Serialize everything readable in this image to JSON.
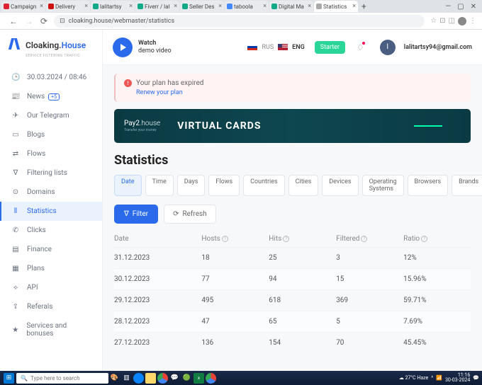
{
  "browser": {
    "tabs": [
      {
        "label": "Campaign",
        "color": "#d23"
      },
      {
        "label": "Delivery",
        "color": "#c11"
      },
      {
        "label": "lalitartsy",
        "color": "#1a8"
      },
      {
        "label": "Fiverr / lal",
        "color": "#1a8"
      },
      {
        "label": "Seller Des",
        "color": "#1a8"
      },
      {
        "label": "taboola",
        "color": "#48f"
      },
      {
        "label": "Digital Ma",
        "color": "#1a8"
      },
      {
        "label": "Statistics",
        "color": "#aaa"
      }
    ],
    "url": "cloaking.house/webmaster/statistics"
  },
  "logo": {
    "main": "Cloaking.",
    "accent": "House",
    "sub": "SERVICE FILTERING TRAFFIC"
  },
  "sidebar": {
    "items": [
      {
        "icon": "🕒",
        "label": "30.03.2024 / 08:46"
      },
      {
        "icon": "📰",
        "label": "News",
        "badge": "+5"
      },
      {
        "icon": "✈",
        "label": "Our Telegram"
      },
      {
        "icon": "▭",
        "label": "Blogs"
      },
      {
        "icon": "⇄",
        "label": "Flows"
      },
      {
        "icon": "∇",
        "label": "Filtering lists"
      },
      {
        "icon": "⊙",
        "label": "Domains"
      },
      {
        "icon": "⫴",
        "label": "Statistics"
      },
      {
        "icon": "✆",
        "label": "Clicks"
      },
      {
        "icon": "▤",
        "label": "Finance"
      },
      {
        "icon": "▦",
        "label": "Plans"
      },
      {
        "icon": "⟡",
        "label": "API"
      },
      {
        "icon": "⇪",
        "label": "Referals"
      },
      {
        "icon": "★",
        "label": "Services and bonuses"
      }
    ]
  },
  "topbar": {
    "watch": {
      "line1": "Watch",
      "line2": "demo video"
    },
    "lang_rus": "RUS",
    "lang_eng": "ENG",
    "starter": "Starter",
    "avatar_initial": "I",
    "email": "lalitartsy94@gmail.com"
  },
  "alert": {
    "title": "Your plan has expired",
    "link": "Renew your plan"
  },
  "banner": {
    "brand": "Pay2",
    "brand2": ".house",
    "sub": "Transfer your money",
    "title": "VIRTUAL CARDS"
  },
  "page": {
    "title": "Statistics"
  },
  "chips": [
    "Date",
    "Time",
    "Days",
    "Flows",
    "Countries",
    "Cities",
    "Devices",
    "Operating Systems",
    "Browsers",
    "Brands"
  ],
  "actions": {
    "filter": "Filter",
    "refresh": "Refresh"
  },
  "table": {
    "headers": [
      "Date",
      "Hosts",
      "Hits",
      "Filtered",
      "Ratio"
    ],
    "rows": [
      {
        "date": "31.12.2023",
        "hosts": "18",
        "hits": "25",
        "filtered": "3",
        "ratio": "12%"
      },
      {
        "date": "30.12.2023",
        "hosts": "77",
        "hits": "94",
        "filtered": "15",
        "ratio": "15.96%"
      },
      {
        "date": "29.12.2023",
        "hosts": "495",
        "hits": "618",
        "filtered": "369",
        "ratio": "59.71%"
      },
      {
        "date": "28.12.2023",
        "hosts": "47",
        "hits": "65",
        "filtered": "5",
        "ratio": "7.69%"
      },
      {
        "date": "27.12.2023",
        "hosts": "136",
        "hits": "154",
        "filtered": "70",
        "ratio": "45.45%"
      }
    ]
  },
  "taskbar": {
    "search_placeholder": "Type here to search",
    "weather": "27°C Haze",
    "time": "11:16",
    "date": "30-03-2024"
  }
}
